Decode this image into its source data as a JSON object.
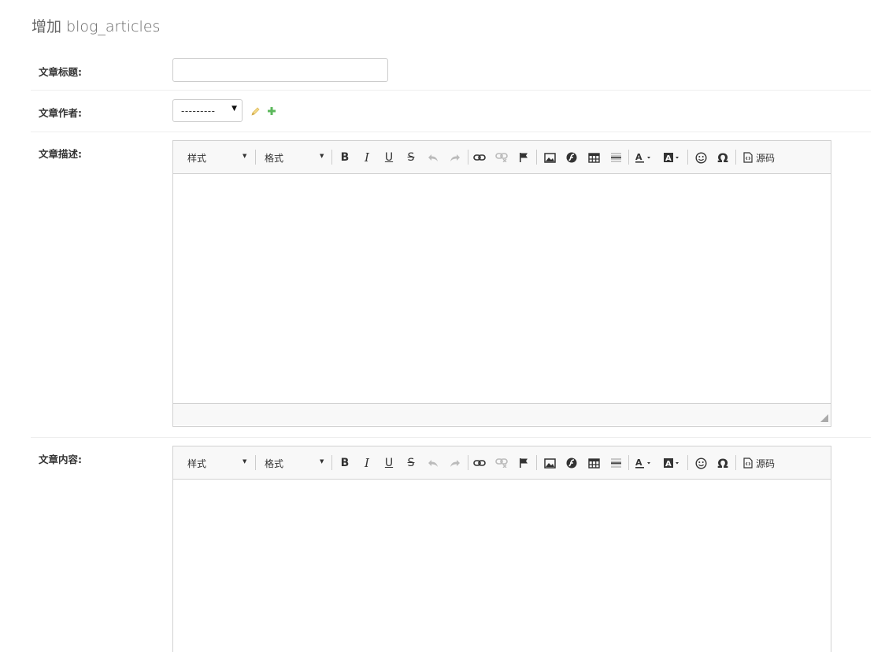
{
  "page": {
    "title": "增加 blog_articles"
  },
  "fields": {
    "title": {
      "label": "文章标题:",
      "value": ""
    },
    "author": {
      "label": "文章作者:",
      "selected": "---------"
    },
    "description": {
      "label": "文章描述:"
    },
    "content": {
      "label": "文章内容:"
    }
  },
  "editor": {
    "style_combo": "样式",
    "format_combo": "格式",
    "source_label": "源码",
    "buttons": [
      "bold",
      "italic",
      "underline",
      "strikethrough",
      "undo",
      "redo",
      "link",
      "unlink",
      "anchor",
      "image",
      "flash",
      "table",
      "horizontal-rule",
      "text-color",
      "background-color",
      "smiley",
      "special-char",
      "source"
    ]
  },
  "colors": {
    "add_icon": "#5cb85c",
    "edit_icon": "#e8c66a",
    "toolbar_bg": "#f8f8f8",
    "border": "#d1d1d1"
  }
}
